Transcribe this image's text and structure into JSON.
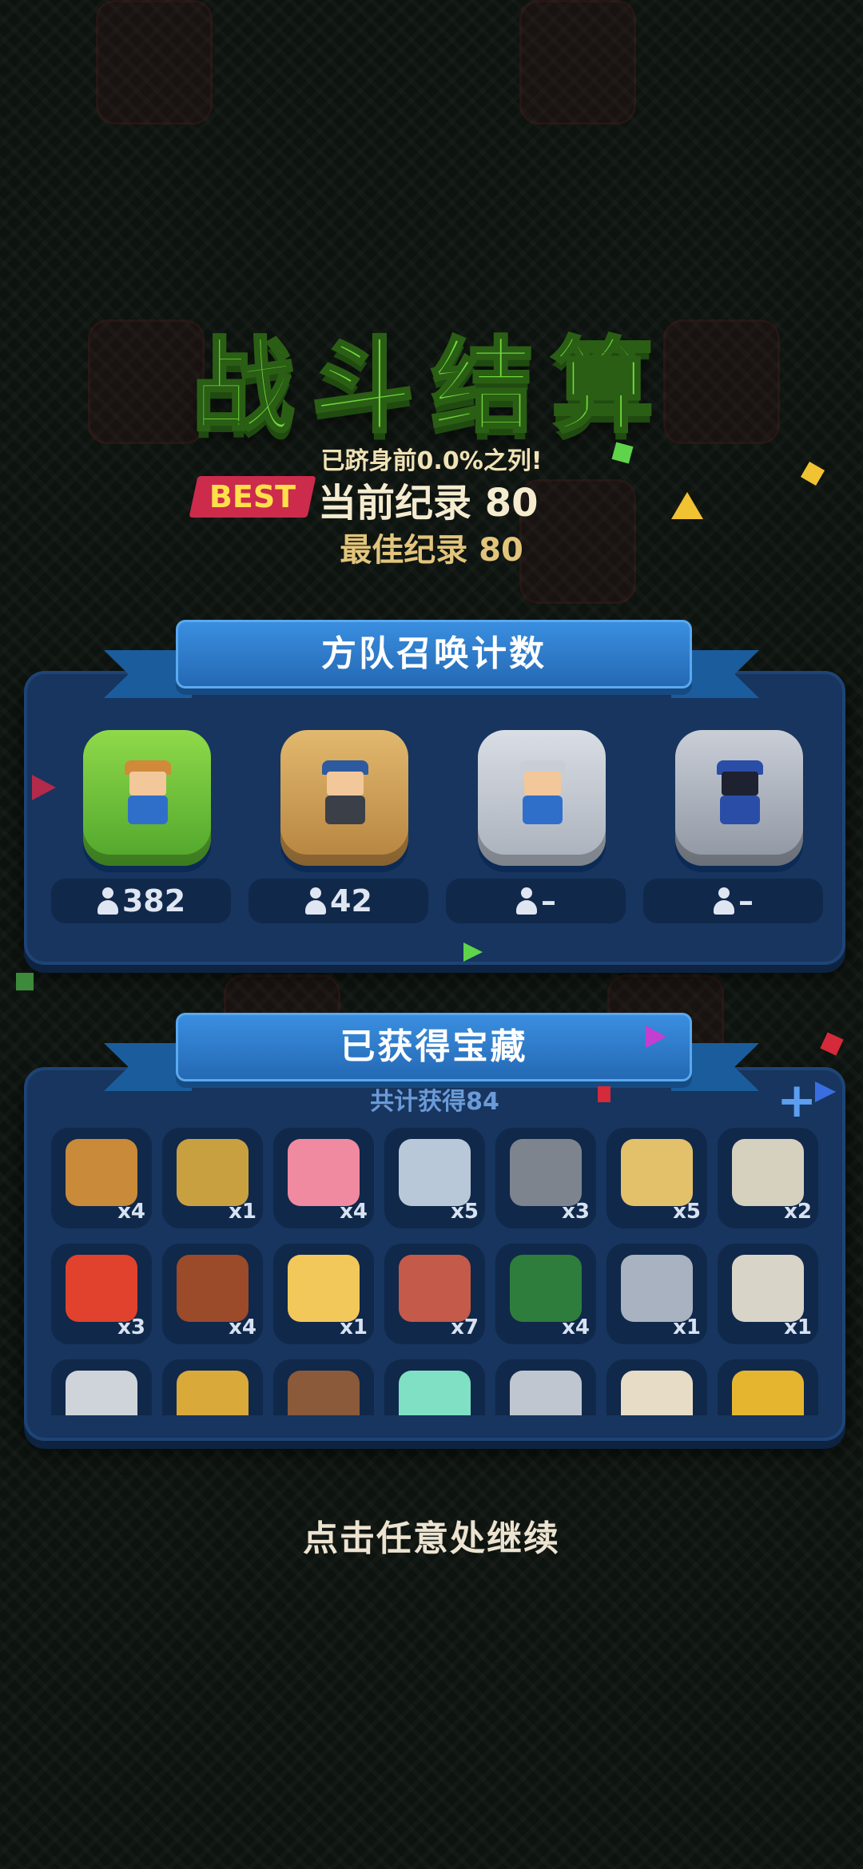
{
  "title": "战斗结算",
  "rank_text": "已跻身前0.0%之列!",
  "best_badge": "BEST",
  "current_record": "当前纪录 80",
  "best_record": "最佳纪录 80",
  "summon_section": {
    "title": "方队召唤计数",
    "units": [
      {
        "name": "archer",
        "count": "382"
      },
      {
        "name": "cannoneer",
        "count": "42"
      },
      {
        "name": "knight",
        "count": "–"
      },
      {
        "name": "mage",
        "count": "–"
      }
    ]
  },
  "treasure_section": {
    "title": "已获得宝藏",
    "total": "共计获得84",
    "items": [
      {
        "icon": "gold-sack-icon",
        "qty": "x4",
        "color": "#c98a3a"
      },
      {
        "icon": "knight-statue-icon",
        "qty": "x1",
        "color": "#c9a040"
      },
      {
        "icon": "piggy-bank-icon",
        "qty": "x4",
        "color": "#f08aa0"
      },
      {
        "icon": "silver-coins-icon",
        "qty": "x5",
        "color": "#b8c8d8"
      },
      {
        "icon": "iron-crate-icon",
        "qty": "x3",
        "color": "#7d848e"
      },
      {
        "icon": "treasure-map-icon",
        "qty": "x5",
        "color": "#e3c06a"
      },
      {
        "icon": "stone-tag-icon",
        "qty": "x2",
        "color": "#d6d0be"
      },
      {
        "icon": "apple-icon",
        "qty": "x3",
        "color": "#e0422d"
      },
      {
        "icon": "gem-chest-icon",
        "qty": "x4",
        "color": "#9b4a2a"
      },
      {
        "icon": "butter-icon",
        "qty": "x1",
        "color": "#f2c85a"
      },
      {
        "icon": "meat-icon",
        "qty": "x7",
        "color": "#c45a4a"
      },
      {
        "icon": "green-banner-icon",
        "qty": "x4",
        "color": "#2e7d3c"
      },
      {
        "icon": "jeweled-sword-icon",
        "qty": "x1",
        "color": "#a8b2c0"
      },
      {
        "icon": "horned-statue-icon",
        "qty": "x1",
        "color": "#d8d4c8"
      },
      {
        "icon": "stone-chest-icon",
        "qty": "",
        "color": "#cfd4da"
      },
      {
        "icon": "golden-scepter-icon",
        "qty": "",
        "color": "#d9a93a"
      },
      {
        "icon": "old-book-icon",
        "qty": "",
        "color": "#8a5a3a"
      },
      {
        "icon": "crystal-icon",
        "qty": "",
        "color": "#7fe0c4"
      },
      {
        "icon": "needle-icon",
        "qty": "",
        "color": "#c0c6cf"
      },
      {
        "icon": "drum-icon",
        "qty": "",
        "color": "#e7dcc6"
      },
      {
        "icon": "magic-lamp-icon",
        "qty": "",
        "color": "#e6b530"
      }
    ]
  },
  "continue_hint": "点击任意处继续",
  "colors": {
    "accent_green": "#6fd83a",
    "panel_blue": "#17355e",
    "ribbon_blue": "#2f7fd0",
    "best_red": "#cc2b4c"
  }
}
